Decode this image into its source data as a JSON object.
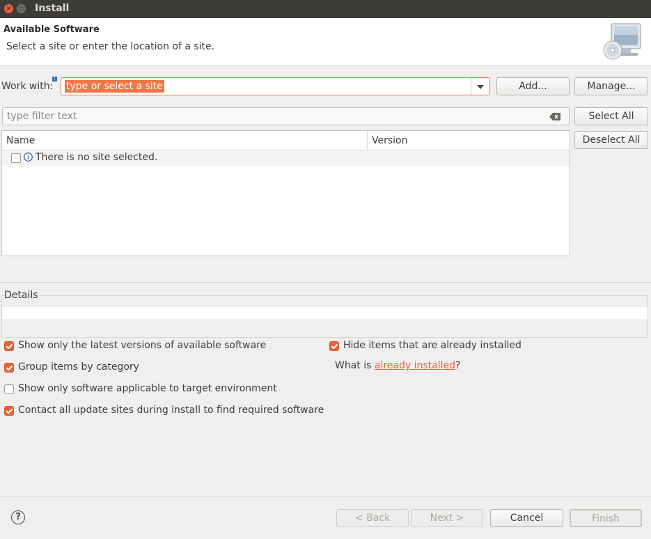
{
  "window": {
    "title": "Install",
    "close_glyph": "×",
    "max_glyph": "▫"
  },
  "header": {
    "title": "Available Software",
    "subtitle": "Select a site or enter the location of a site.",
    "icon": "software-cd-computer-icon"
  },
  "work_with": {
    "label": "Work with:",
    "info_glyph": "i",
    "value": "type or select a site",
    "add_label": "Add...",
    "manage_label": "Manage..."
  },
  "filter": {
    "placeholder": "type filter text"
  },
  "buttons": {
    "select_all": "Select All",
    "deselect_all": "Deselect All"
  },
  "table": {
    "columns": [
      "Name",
      "Version"
    ],
    "rows": [
      {
        "name": "There is no site selected.",
        "version": "",
        "checked": false
      }
    ]
  },
  "details": {
    "title": "Details"
  },
  "options": {
    "latest_versions": {
      "label": "Show only the latest versions of available software",
      "checked": true
    },
    "group_by_category": {
      "label": "Group items by category",
      "checked": true
    },
    "applicable_target": {
      "label": "Show only software applicable to target environment",
      "checked": false
    },
    "contact_sites": {
      "label": "Contact all update sites during install to find required software",
      "checked": true
    },
    "hide_installed": {
      "label": "Hide items that are already installed",
      "checked": true
    },
    "what_is_prefix": "What is ",
    "what_is_link": "already installed",
    "what_is_suffix": "?"
  },
  "footer": {
    "help_glyph": "?",
    "back": "< Back",
    "next": "Next >",
    "cancel": "Cancel",
    "finish": "Finish"
  },
  "colors": {
    "accent": "#e9643a",
    "titlebar": "#3d3c38",
    "background": "#f0efed"
  }
}
